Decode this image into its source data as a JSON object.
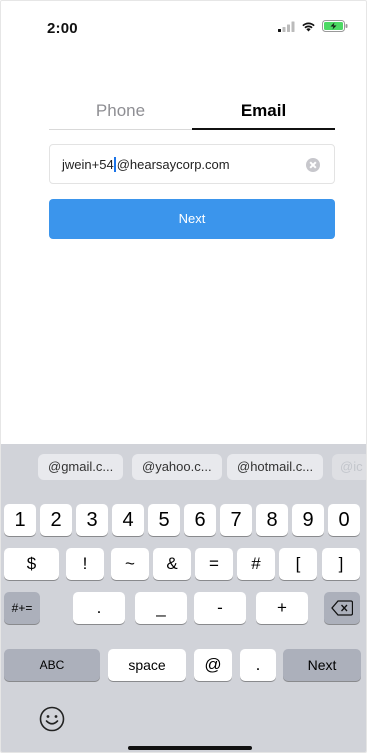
{
  "status_bar": {
    "time": "2:00"
  },
  "tabs": [
    {
      "label": "Phone",
      "active": false
    },
    {
      "label": "Email",
      "active": true
    }
  ],
  "email_input": {
    "value_before_caret": "jwein+54",
    "value_after_caret": "@hearsaycorp.com"
  },
  "next_button": {
    "label": "Next"
  },
  "keyboard": {
    "suggestions": [
      "@gmail.c...",
      "@yahoo.c...",
      "@hotmail.c...",
      "@ic"
    ],
    "row1": [
      "1",
      "2",
      "3",
      "4",
      "5",
      "6",
      "7",
      "8",
      "9",
      "0"
    ],
    "row2": [
      "$",
      "!",
      "~",
      "&",
      "=",
      "#",
      "[",
      "]"
    ],
    "row3": {
      "toggle": "#+=",
      "keys": [
        ".",
        "_",
        "-",
        "+"
      ]
    },
    "row4": {
      "abc": "ABC",
      "space": "space",
      "at": "@",
      "dot": ".",
      "next": "Next"
    }
  },
  "colors": {
    "accent": "#3b95ec",
    "keyboard_bg": "#d1d3d9",
    "battery": "#4cd964"
  },
  "icons": [
    "signal-icon",
    "wifi-icon",
    "battery-charging-icon",
    "clear-icon",
    "backspace-icon",
    "emoji-icon"
  ]
}
